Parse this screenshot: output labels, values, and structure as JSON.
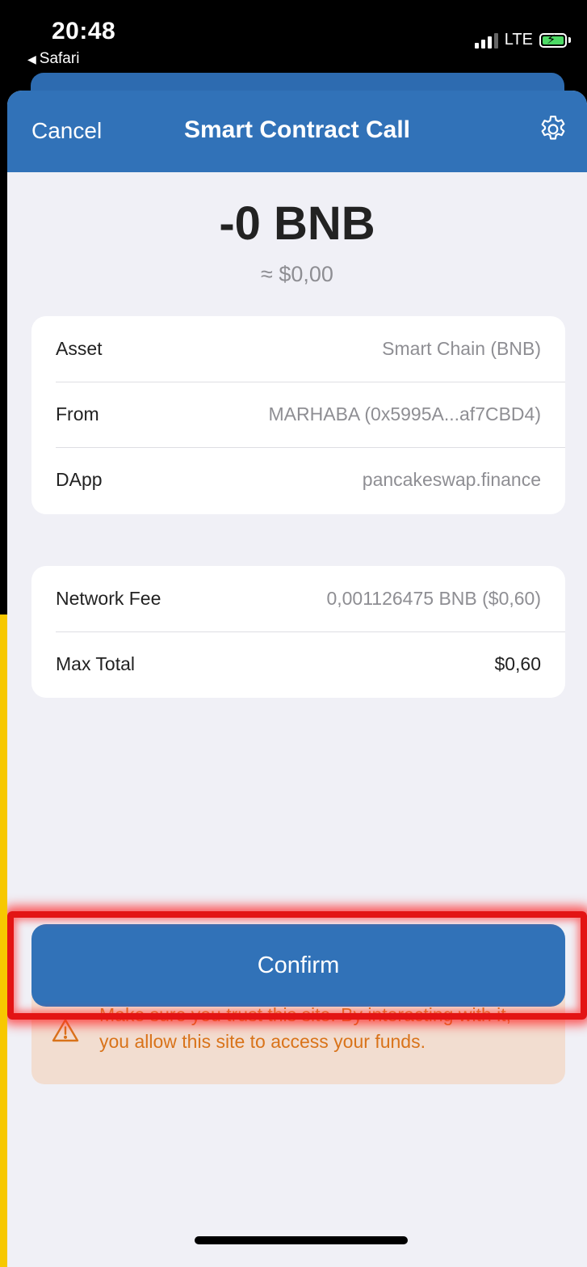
{
  "status_bar": {
    "time": "20:48",
    "back_app": "Safari",
    "network": "LTE",
    "back_icon": "back-triangle-icon",
    "signal_icon": "signal-bars-icon",
    "battery_icon": "battery-charging-icon"
  },
  "nav": {
    "cancel_label": "Cancel",
    "title": "Smart Contract Call",
    "settings_icon": "gear-icon",
    "color": "#3172b8"
  },
  "amount": {
    "value": "-0 BNB",
    "fiat": "≈ $0,00"
  },
  "details": [
    {
      "label": "Asset",
      "value": "Smart Chain (BNB)"
    },
    {
      "label": "From",
      "value": "MARHABA (0x5995A...af7CBD4)"
    },
    {
      "label": "DApp",
      "value": "pancakeswap.finance"
    }
  ],
  "fees": [
    {
      "label": "Network Fee",
      "value": "0,001126475 BNB ($0,60)"
    },
    {
      "label": "Max Total",
      "value": "$0,60"
    }
  ],
  "warning": {
    "icon": "warning-triangle-icon",
    "text": "Make sure you trust this site. By interacting with it, you allow this site to access your funds.",
    "color": "#d9731a"
  },
  "confirm_label": "Confirm",
  "highlight_color": "#e31414"
}
